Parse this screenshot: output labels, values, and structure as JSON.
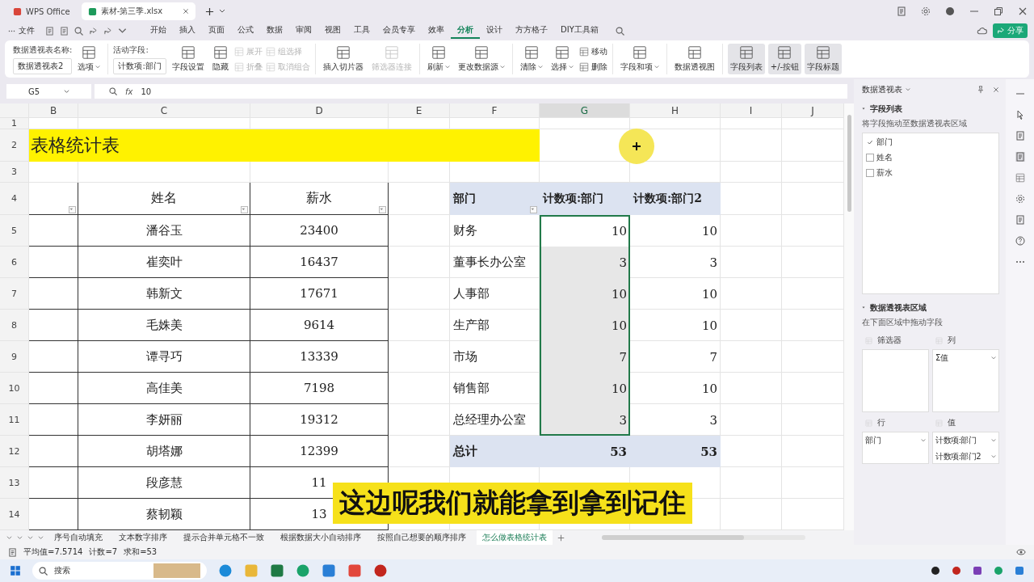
{
  "window": {
    "tabs": [
      {
        "label": "WPS Office",
        "kind": "home",
        "selected": false
      },
      {
        "label": "素材-第三季.xlsx",
        "kind": "file",
        "selected": true
      }
    ]
  },
  "menu": {
    "file": "文件",
    "tabs": [
      {
        "label": "开始",
        "selected": false
      },
      {
        "label": "插入",
        "selected": false
      },
      {
        "label": "页面",
        "selected": false
      },
      {
        "label": "公式",
        "selected": false
      },
      {
        "label": "数据",
        "selected": false
      },
      {
        "label": "审阅",
        "selected": false
      },
      {
        "label": "视图",
        "selected": false
      },
      {
        "label": "工具",
        "selected": false
      },
      {
        "label": "会员专享",
        "selected": false
      },
      {
        "label": "效率",
        "selected": false
      },
      {
        "label": "分析",
        "selected": true
      },
      {
        "label": "设计",
        "selected": false
      },
      {
        "label": "方方格子",
        "selected": false
      },
      {
        "label": "DIY工具箱",
        "selected": false
      }
    ],
    "share": "分享"
  },
  "ribbon": {
    "groups": [
      {
        "items": [
          {
            "kind": "namefield",
            "label": "数据透视表名称:",
            "value": "数据透视表2"
          },
          {
            "kind": "big",
            "label": "选项",
            "dropdown": true,
            "disabled": false,
            "pressed": false
          }
        ]
      },
      {
        "items": [
          {
            "kind": "namefield",
            "label": "活动字段:",
            "value": "计数项:部门"
          },
          {
            "kind": "big",
            "label": "字段设置",
            "dropdown": false,
            "disabled": false,
            "pressed": false
          },
          {
            "kind": "big",
            "label": "隐藏",
            "dropdown": false,
            "disabled": false,
            "pressed": false
          },
          {
            "kind": "stack",
            "items": [
              {
                "label": "展开",
                "disabled": true
              },
              {
                "label": "折叠",
                "disabled": true
              }
            ]
          },
          {
            "kind": "stack",
            "items": [
              {
                "label": "组选择",
                "disabled": true
              },
              {
                "label": "取消组合",
                "disabled": true
              }
            ]
          }
        ]
      },
      {
        "items": [
          {
            "kind": "big",
            "label": "插入切片器",
            "dropdown": false,
            "disabled": false,
            "pressed": false
          },
          {
            "kind": "big",
            "label": "筛选器连接",
            "dropdown": false,
            "disabled": true,
            "pressed": false
          }
        ]
      },
      {
        "items": [
          {
            "kind": "big",
            "label": "刷新",
            "dropdown": true,
            "disabled": false,
            "pressed": false
          },
          {
            "kind": "big",
            "label": "更改数据源",
            "dropdown": true,
            "disabled": false,
            "pressed": false
          }
        ]
      },
      {
        "items": [
          {
            "kind": "big",
            "label": "清除",
            "dropdown": true,
            "disabled": false,
            "pressed": false
          },
          {
            "kind": "big",
            "label": "选择",
            "dropdown": true,
            "disabled": false,
            "pressed": false
          },
          {
            "kind": "stack",
            "items": [
              {
                "label": "移动",
                "disabled": false
              },
              {
                "label": "删除",
                "disabled": false
              }
            ]
          }
        ]
      },
      {
        "items": [
          {
            "kind": "big",
            "label": "字段和项",
            "dropdown": true,
            "disabled": false,
            "pressed": false
          }
        ]
      },
      {
        "items": [
          {
            "kind": "big",
            "label": "数据透视图",
            "dropdown": false,
            "disabled": false,
            "pressed": false
          }
        ]
      },
      {
        "items": [
          {
            "kind": "big",
            "label": "字段列表",
            "dropdown": false,
            "disabled": false,
            "pressed": true
          },
          {
            "kind": "big",
            "label": "+/-按钮",
            "dropdown": false,
            "disabled": false,
            "pressed": true
          },
          {
            "kind": "big",
            "label": "字段标题",
            "dropdown": false,
            "disabled": false,
            "pressed": true
          }
        ]
      }
    ]
  },
  "formula_bar": {
    "name_box": "G5",
    "function_label": "fx",
    "value": "10"
  },
  "sheet": {
    "columns": [
      {
        "label": "B",
        "selected": false
      },
      {
        "label": "C",
        "selected": false
      },
      {
        "label": "D",
        "selected": false
      },
      {
        "label": "E",
        "selected": false
      },
      {
        "label": "F",
        "selected": false
      },
      {
        "label": "G",
        "selected": true
      },
      {
        "label": "H",
        "selected": false
      },
      {
        "label": "I",
        "selected": false
      },
      {
        "label": "J",
        "selected": false
      }
    ],
    "rows": [
      "1",
      "2",
      "3",
      "4",
      "5",
      "6",
      "7",
      "8",
      "9",
      "10",
      "11",
      "12",
      "13",
      "14"
    ],
    "title": "表格统计表",
    "table": {
      "header": [
        "姓名",
        "薪水"
      ],
      "rows": [
        [
          "潘谷玉",
          "23400"
        ],
        [
          "崔奕叶",
          "16437"
        ],
        [
          "韩新文",
          "17671"
        ],
        [
          "毛姝美",
          "9614"
        ],
        [
          "谭寻巧",
          "13339"
        ],
        [
          "高佳美",
          "7198"
        ],
        [
          "李妍丽",
          "19312"
        ],
        [
          "胡塔娜",
          "12399"
        ],
        [
          "段彦慧",
          "11"
        ],
        [
          "蔡韧颖",
          "13"
        ]
      ]
    },
    "pivot": {
      "header": [
        "部门",
        "计数项:部门",
        "计数项:部门2"
      ],
      "rows": [
        {
          "cells": [
            "财务",
            "10",
            "10"
          ],
          "selected": true
        },
        {
          "cells": [
            "董事长办公室",
            "3",
            "3"
          ],
          "selected": true
        },
        {
          "cells": [
            "人事部",
            "10",
            "10"
          ],
          "selected": true
        },
        {
          "cells": [
            "生产部",
            "10",
            "10"
          ],
          "selected": true
        },
        {
          "cells": [
            "市场",
            "7",
            "7"
          ],
          "selected": true
        },
        {
          "cells": [
            "销售部",
            "10",
            "10"
          ],
          "selected": true
        },
        {
          "cells": [
            "总经理办公室",
            "3",
            "3"
          ],
          "selected": true
        }
      ],
      "total": [
        "总计",
        "53",
        "53"
      ]
    },
    "caption": "这边呢我们就能拿到拿到记住"
  },
  "sheet_tabs": [
    {
      "label": "序号自动填充",
      "selected": false
    },
    {
      "label": "文本数字排序",
      "selected": false
    },
    {
      "label": "提示合并单元格不一致",
      "selected": false
    },
    {
      "label": "根据数据大小自动排序",
      "selected": false
    },
    {
      "label": "按照自己想要的顺序排序",
      "selected": false
    },
    {
      "label": "怎么做表格统计表",
      "selected": true
    }
  ],
  "panel": {
    "title": "数据透视表",
    "field_section": "字段列表",
    "field_hint": "将字段拖动至数据透视表区域",
    "fields": [
      {
        "label": "部门",
        "checked": true
      },
      {
        "label": "姓名",
        "checked": false
      },
      {
        "label": "薪水",
        "checked": false
      }
    ],
    "area_section": "数据透视表区域",
    "area_hint": "在下面区域中拖动字段",
    "areas": [
      {
        "label": "筛选器"
      },
      {
        "label": "列",
        "items": [
          "Σ值"
        ]
      },
      {
        "label": "行",
        "items": [
          "部门"
        ]
      },
      {
        "label": "值",
        "items": [
          "计数项:部门",
          "计数项:部门2"
        ]
      }
    ]
  },
  "status_bar": {
    "stats": [
      "平均值=7.5714",
      "计数=7",
      "求和=53"
    ]
  },
  "taskbar": {
    "search": "搜索"
  }
}
